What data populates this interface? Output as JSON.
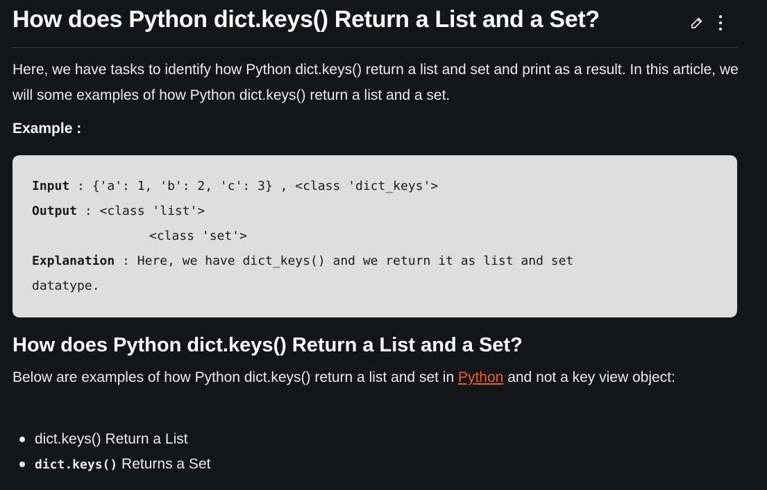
{
  "article": {
    "title": "How does Python dict.keys() Return a List and a Set?",
    "intro": "Here, we have tasks to identify how Python dict.keys() return a list and set and print as a result. In this article, we will some examples of how Python dict.keys() return a list and a set.",
    "example_label": "Example :"
  },
  "icons": {
    "edit": "pencil-icon",
    "more": "more-vertical-icon"
  },
  "code_block": {
    "input_key": "Input",
    "input_value": " : {'a': 1, 'b': 2, 'c': 3} , <class 'dict_keys'>",
    "output_key": "Output",
    "output_value": " : <class 'list'>",
    "output_continuation": "<class 'set'>",
    "explanation_key": "Explanation",
    "explanation_value": " : Here, we have dict_keys() and we return it as list and set",
    "explanation_continuation": "datatype."
  },
  "section": {
    "heading": "How does Python dict.keys() Return a List and a Set?",
    "text_before_link": "Below are examples of how Python dict.keys() return a list and set in ",
    "link_text": "Python",
    "text_after_link": " and not a key view object:",
    "bullets": [
      {
        "text": "dict.keys() Return a List"
      },
      {
        "code": "dict.keys()",
        "text": " Returns a Set"
      }
    ]
  },
  "colors": {
    "background": "#141518",
    "code_background": "#dedede",
    "link": "#ec5f2c"
  }
}
